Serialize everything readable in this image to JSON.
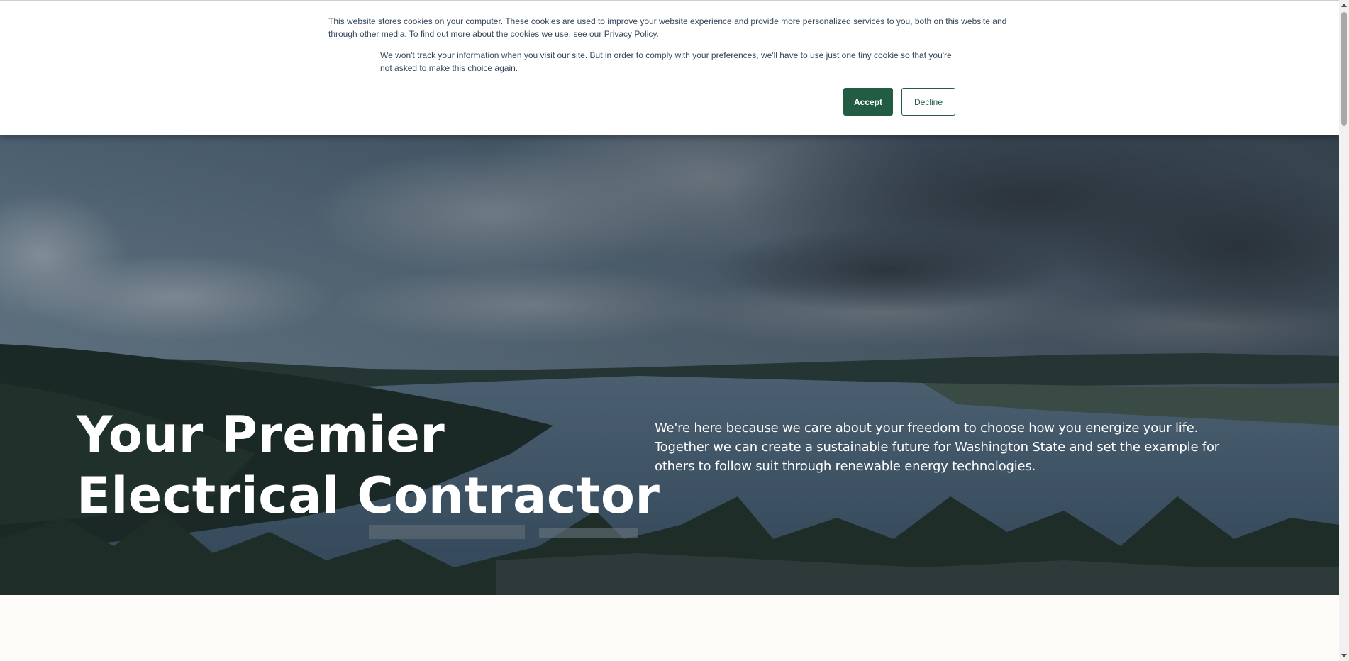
{
  "cookie_banner": {
    "main_text": "This website stores cookies on your computer. These cookies are used to improve your website experience and provide more personalized services to you, both on this website and through other media. To find out more about the cookies we use, see our ",
    "privacy_link": "Privacy Policy",
    "main_text_end": ".",
    "secondary_text": "We won't track your information when you visit our site. But in order to comply with your preferences, we'll have to use just one tiny cookie so that you're not asked to make this choice again.",
    "accept_label": "Accept",
    "decline_label": "Decline"
  },
  "hero": {
    "title_line1": "Your Premier",
    "title_line2": "Electrical Contractor",
    "description": "We're here because we care about your freedom to choose how you energize your life. Together we can create a sustainable future for Washington State and set the example for others to follow suit through renewable energy technologies."
  },
  "colors": {
    "brand_green": "#225c42",
    "page_background": "#fdfcf9",
    "banner_text": "#33475b"
  }
}
